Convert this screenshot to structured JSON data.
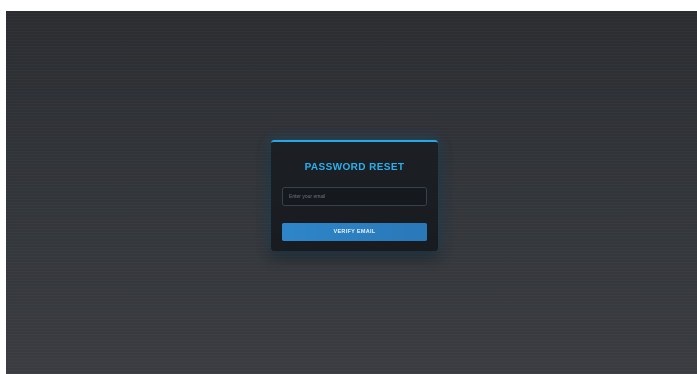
{
  "form": {
    "title": "PASSWORD RESET",
    "email_placeholder": "Enter your email",
    "email_value": "",
    "submit_label": "VERIFY EMAIL"
  },
  "colors": {
    "accent": "#26a7e6",
    "button": "#2e86c8",
    "card_background": "#1c1f24",
    "page_background": "#33363b"
  }
}
